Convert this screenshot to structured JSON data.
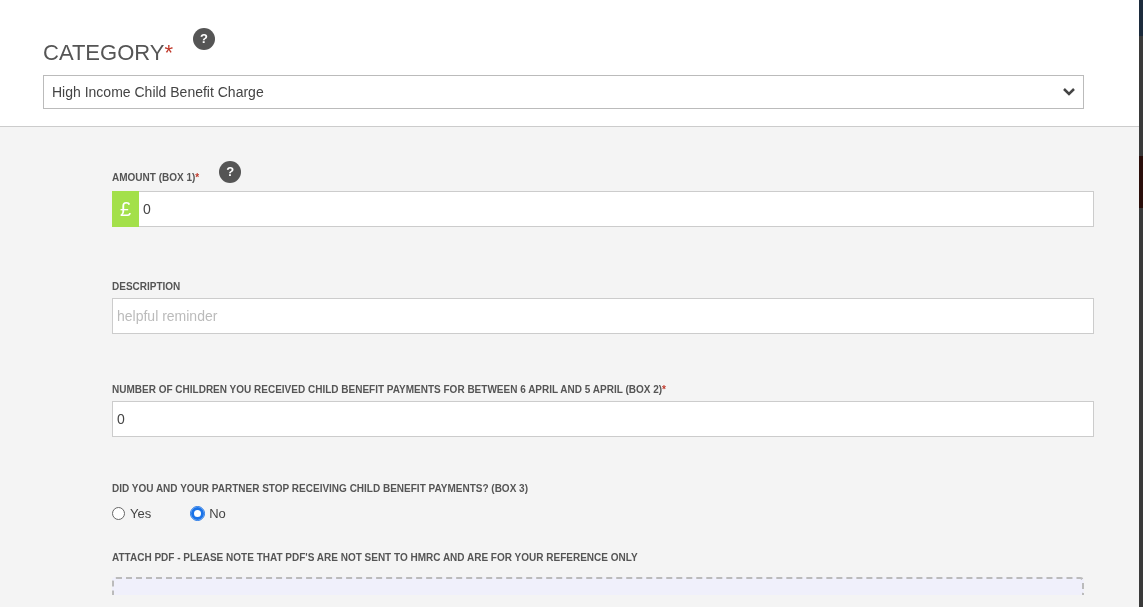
{
  "category": {
    "label": "CATEGORY",
    "required_mark": "*",
    "help": "?",
    "value": "High Income Child Benefit Charge"
  },
  "fields": [
    {
      "kind": "currency",
      "label": "AMOUNT (BOX 1)",
      "required_mark": "*",
      "help": "?",
      "prefix": "£",
      "value": "0"
    },
    {
      "kind": "text",
      "label": "DESCRIPTION",
      "placeholder": "helpful reminder"
    },
    {
      "kind": "text",
      "label": "NUMBER OF CHILDREN YOU RECEIVED CHILD BENEFIT PAYMENTS FOR BETWEEN 6 APRIL AND 5 APRIL (BOX 2)",
      "required_mark": "*",
      "value": "0"
    },
    {
      "kind": "radio",
      "label": "DID YOU AND YOUR PARTNER STOP RECEIVING CHILD BENEFIT PAYMENTS? (BOX 3)",
      "options": [
        {
          "label": "Yes",
          "selected": false
        },
        {
          "label": "No",
          "selected": true
        }
      ]
    },
    {
      "kind": "upload",
      "label": "ATTACH PDF - PLEASE NOTE THAT PDF'S ARE NOT SENT TO HMRC AND ARE FOR YOUR REFERENCE ONLY"
    }
  ]
}
